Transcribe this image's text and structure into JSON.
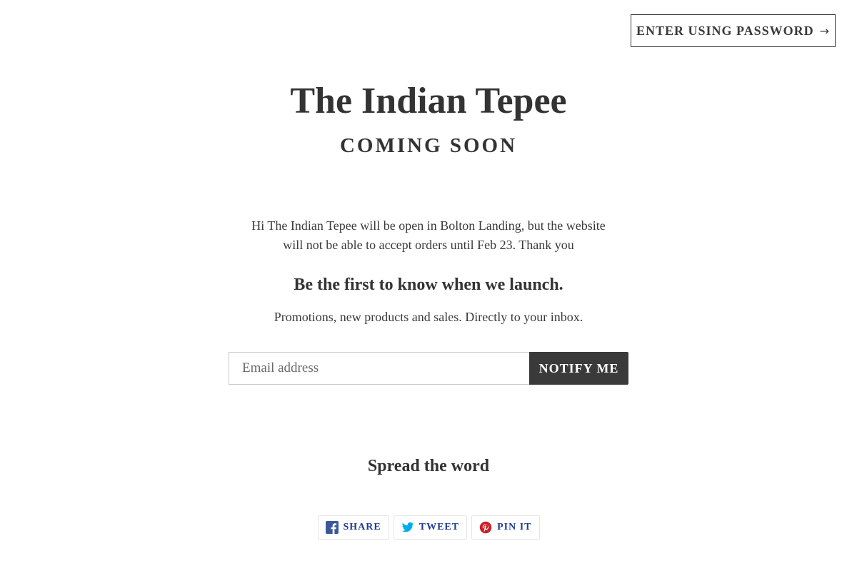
{
  "header": {
    "password_label": "ENTER USING PASSWORD",
    "password_arrow": "→"
  },
  "hero": {
    "brand": "The Indian Tepee",
    "tagline": "COMING SOON"
  },
  "intro": {
    "message": "Hi The Indian Tepee will be open in Bolton Landing, but the website will not be able to accept orders until Feb 23. Thank you"
  },
  "newsletter": {
    "heading": "Be the first to know when we launch.",
    "subtext": "Promotions, new products and sales. Directly to your inbox.",
    "email_placeholder": "Email address",
    "email_value": "",
    "submit_label": "NOTIFY ME"
  },
  "social": {
    "heading": "Spread the word",
    "buttons": [
      {
        "label": "SHARE",
        "icon": "facebook-icon",
        "color": "#3b5998"
      },
      {
        "label": "TWEET",
        "icon": "twitter-icon",
        "color": "#00aced"
      },
      {
        "label": "PIN IT",
        "icon": "pinterest-icon",
        "color": "#cb2027"
      }
    ]
  },
  "colors": {
    "text": "#333333",
    "button_dark": "#3a3a3a",
    "share_text": "#1f3a93"
  }
}
